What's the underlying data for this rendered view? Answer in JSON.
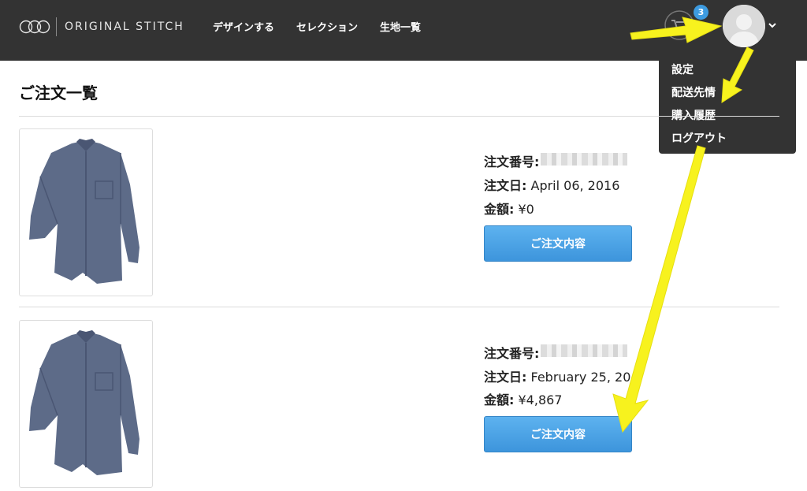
{
  "header": {
    "brand": "ORIGINAL STITCH",
    "nav": [
      "デザインする",
      "セレクション",
      "生地一覧"
    ],
    "cart_count": "3"
  },
  "dropdown": {
    "items": [
      "設定",
      "配送先情",
      "購入履歴",
      "ログアウト"
    ]
  },
  "main": {
    "title": "ご注文一覧",
    "orders": [
      {
        "number_label": "注文番号:",
        "date_label": "注文日:",
        "date_value": " April 06, 2016",
        "amount_label": "金額:",
        "amount_value": " ¥0",
        "button_label": "ご注文内容"
      },
      {
        "number_label": "注文番号:",
        "date_label": "注文日:",
        "date_value": " February 25, 20",
        "amount_label": "金額:",
        "amount_value": " ¥4,867",
        "button_label": "ご注文内容"
      }
    ]
  },
  "colors": {
    "header_bg": "#333333",
    "button_blue": "#4aa3e6",
    "badge_blue": "#3d9be0",
    "annotation_yellow": "#f7f21e"
  },
  "icons": [
    "logo-mark-icon",
    "cart-icon",
    "avatar-icon",
    "chevron-down-icon",
    "shirt-icon"
  ]
}
